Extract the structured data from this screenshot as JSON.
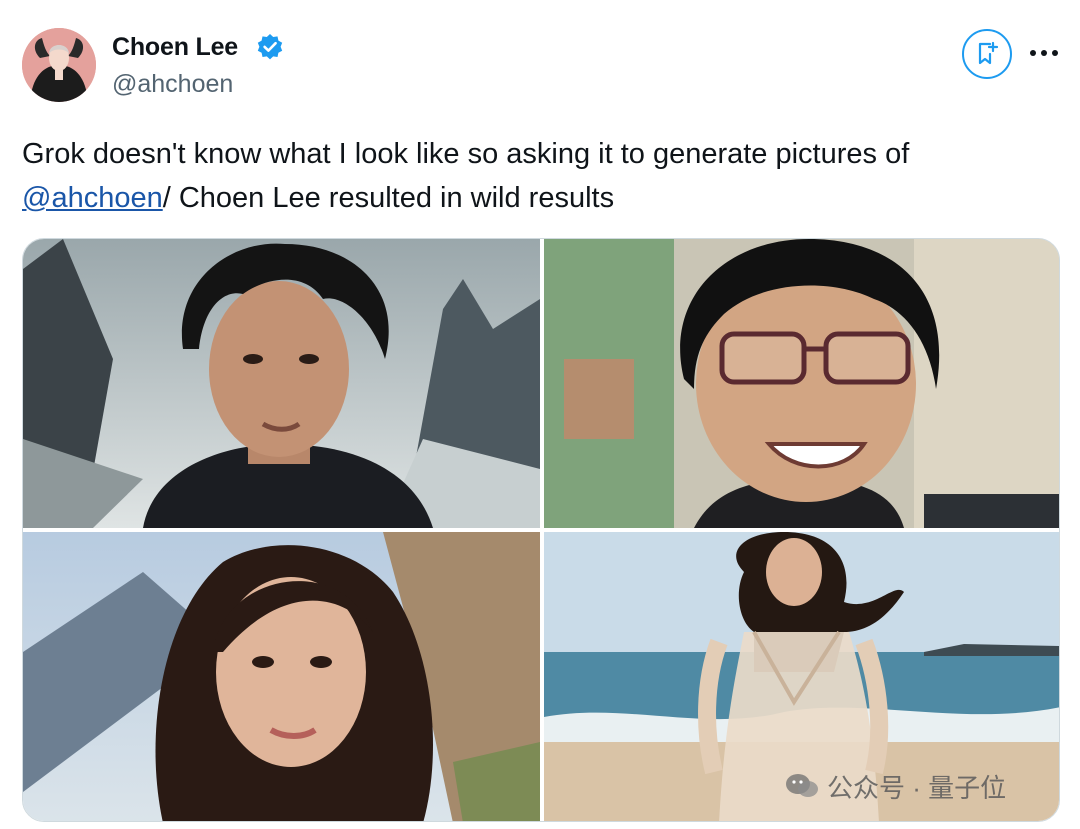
{
  "author": {
    "display_name": "Choen Lee",
    "handle": "@ahchoen",
    "verified": true,
    "avatar_icon": "avatar-image"
  },
  "actions": {
    "grok_icon": "grok-icon",
    "more_icon": "more-icon"
  },
  "tweet": {
    "text_part1": "Grok doesn't know what I look like so asking it to generate pictures of",
    "mention": "@ahchoen",
    "text_part2": "/ Choen Lee resulted in wild results"
  },
  "media": {
    "images": [
      {
        "subject": "man-mountain-fantasy-portrait"
      },
      {
        "subject": "smiling-man-glasses-portrait"
      },
      {
        "subject": "woman-long-hair-portrait"
      },
      {
        "subject": "woman-beach-dress-photo"
      }
    ]
  },
  "watermark": {
    "text": "公众号 · 量子位"
  },
  "colors": {
    "accent": "#1d9bf0",
    "mention": "#1a56a8",
    "secondary_text": "#536471"
  }
}
